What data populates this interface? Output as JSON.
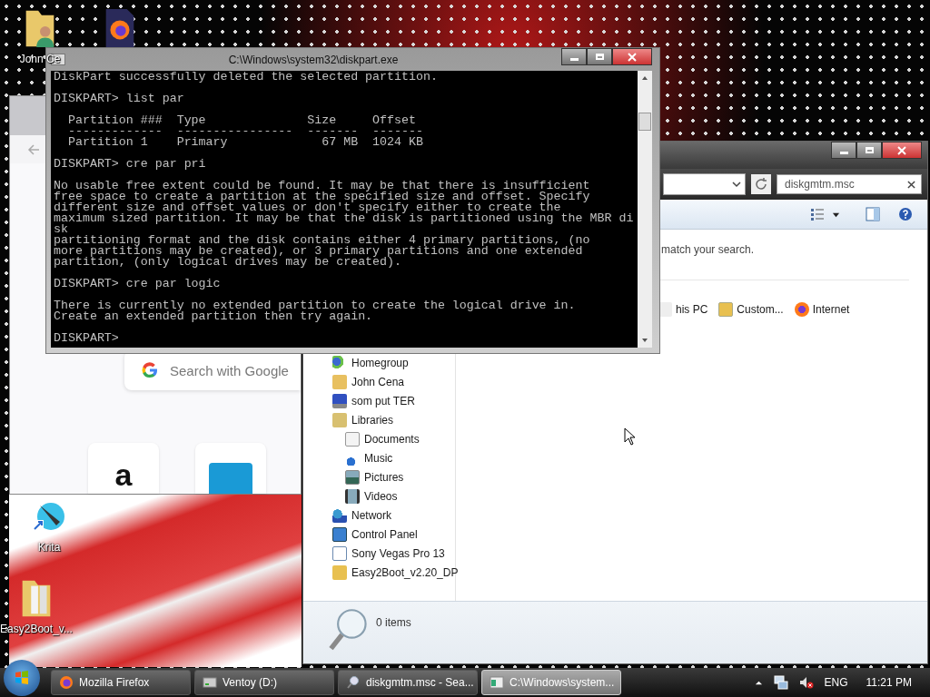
{
  "desktop_icons": [
    {
      "kind": "user-folder",
      "label": "John Ce"
    },
    {
      "kind": "firefox-file"
    },
    {
      "kind": "krita",
      "label": "Krita"
    },
    {
      "kind": "folder",
      "label": "Easy2Boot_v..."
    }
  ],
  "browser_window": {
    "search_placeholder": "Search with Google",
    "shortcuts": [
      {
        "kind": "amazon",
        "glyph": "a"
      },
      {
        "kind": "swissign"
      }
    ]
  },
  "explorer_window": {
    "search_value": "diskgmtm.msc",
    "message": "match your search.",
    "search_again_in": [
      {
        "kind": "pc",
        "label": "his PC"
      },
      {
        "kind": "custom",
        "label": "Custom..."
      },
      {
        "kind": "internet",
        "label": "Internet"
      }
    ],
    "nav_items": [
      {
        "kind": "homegroup",
        "label": "Homegroup"
      },
      {
        "kind": "user",
        "label": "John Cena"
      },
      {
        "kind": "computer",
        "label": "som put TER"
      },
      {
        "kind": "libraries",
        "label": "Libraries",
        "children": [
          {
            "kind": "documents",
            "label": "Documents"
          },
          {
            "kind": "music",
            "label": "Music"
          },
          {
            "kind": "pictures",
            "label": "Pictures"
          },
          {
            "kind": "videos",
            "label": "Videos"
          }
        ]
      },
      {
        "kind": "network",
        "label": "Network"
      },
      {
        "kind": "control-panel",
        "label": "Control Panel"
      },
      {
        "kind": "app",
        "label": "Sony Vegas Pro 13"
      },
      {
        "kind": "folder",
        "label": "Easy2Boot_v2.20_DP"
      }
    ],
    "status": "0 items"
  },
  "console_window": {
    "title": "C:\\Windows\\system32\\diskpart.exe",
    "output": "DiskPart successfully deleted the selected partition.\n\nDISKPART> list par\n\n  Partition ###  Type              Size     Offset\n  -------------  ----------------  -------  -------\n  Partition 1    Primary             67 MB  1024 KB\n\nDISKPART> cre par pri\n\nNo usable free extent could be found. It may be that there is insufficient\nfree space to create a partition at the specified size and offset. Specify\ndifferent size and offset values or don't specify either to create the\nmaximum sized partition. It may be that the disk is partitioned using the MBR di\nsk\npartitioning format and the disk contains either 4 primary partitions, (no\nmore partitions may be created), or 3 primary partitions and one extended\npartition, (only logical drives may be created).\n\nDISKPART> cre par logic\n\nThere is currently no extended partition to create the logical drive in.\nCreate an extended partition then try again.\n\nDISKPART>"
  },
  "taskbar": {
    "tasks": [
      {
        "kind": "firefox",
        "label": "Mozilla Firefox",
        "selected": false
      },
      {
        "kind": "drive",
        "label": "Ventoy (D:)",
        "selected": false
      },
      {
        "kind": "search",
        "label": "diskgmtm.msc - Sea...",
        "selected": false
      },
      {
        "kind": "console",
        "label": "C:\\Windows\\system...",
        "selected": true
      }
    ],
    "language": "ENG",
    "clock": "11:21 PM"
  }
}
